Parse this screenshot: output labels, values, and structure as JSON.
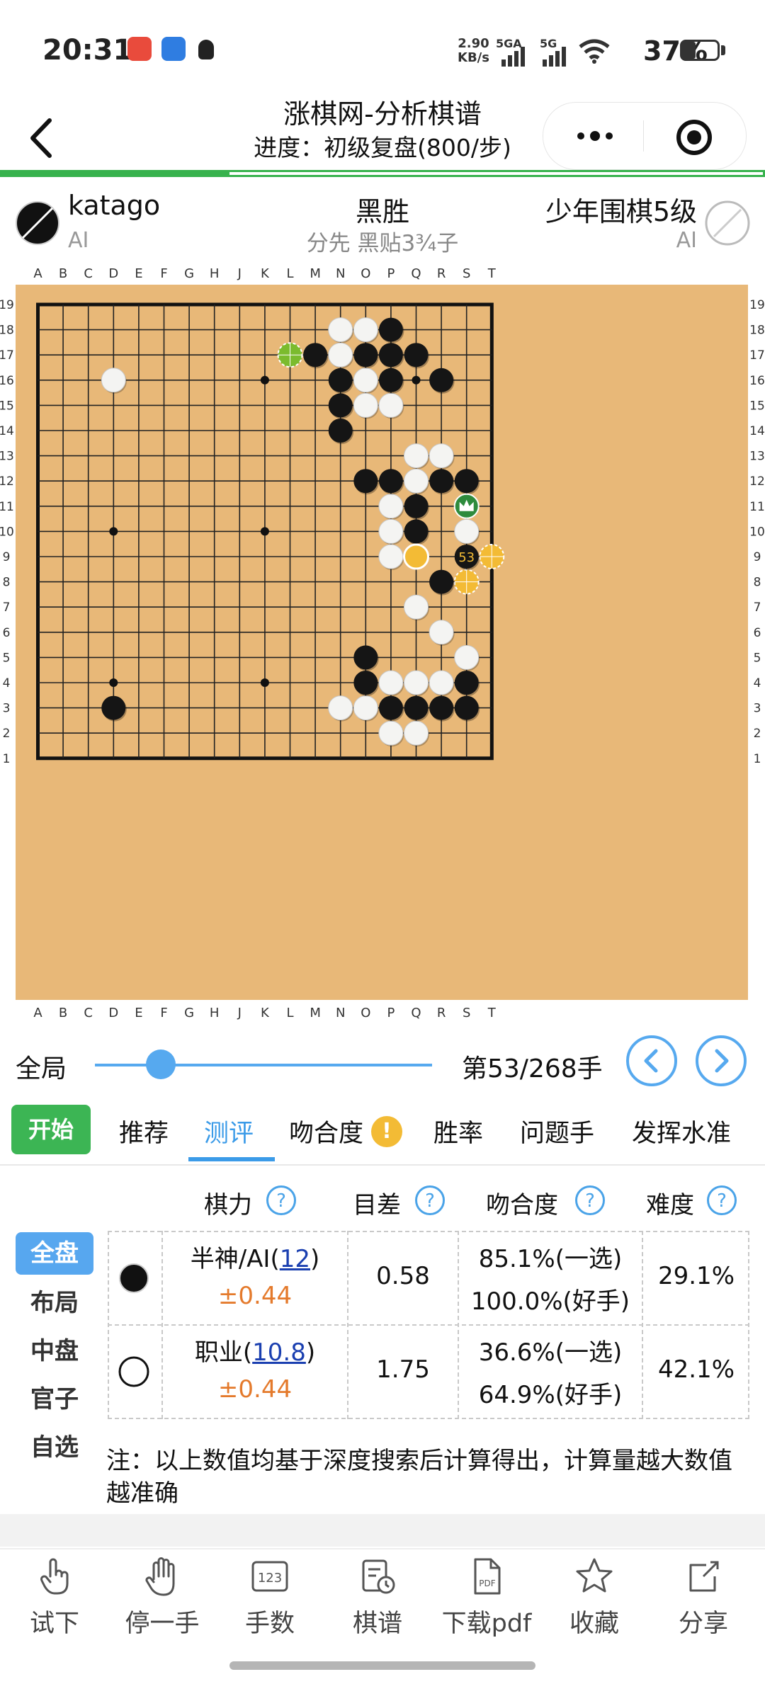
{
  "status": {
    "time": "20:31",
    "net_speed_value": "2.90",
    "net_speed_unit": "KB/s",
    "signal1_label": "5GA",
    "signal2_label": "5G",
    "battery": "37%",
    "battery_level": 0.37
  },
  "header": {
    "title": "涨棋网-分析棋谱",
    "subtitle": "进度：初级复盘(800/步)",
    "progress_fraction": 0.3
  },
  "players": {
    "black": {
      "name": "katago",
      "type": "AI"
    },
    "white": {
      "name": "少年围棋5级",
      "type": "AI"
    },
    "result": "黑胜",
    "rules": "分先 黑贴3¾子"
  },
  "board": {
    "columns": [
      "A",
      "B",
      "C",
      "D",
      "E",
      "F",
      "G",
      "H",
      "J",
      "K",
      "L",
      "M",
      "N",
      "O",
      "P",
      "Q",
      "R",
      "S",
      "T"
    ],
    "rows": [
      "19",
      "18",
      "17",
      "16",
      "15",
      "14",
      "13",
      "12",
      "11",
      "10",
      "9",
      "8",
      "7",
      "6",
      "5",
      "4",
      "3",
      "2",
      "1"
    ],
    "last_move": "S9",
    "last_move_number": "53",
    "black_stones": [
      "P18",
      "M17",
      "O17",
      "P17",
      "Q17",
      "N16",
      "P16",
      "R16",
      "N15",
      "N14",
      "O12",
      "P12",
      "R12",
      "S12",
      "Q11",
      "Q10",
      "R8",
      "O5",
      "O4",
      "S4",
      "P3",
      "Q3",
      "R3",
      "S3",
      "D3",
      "S9"
    ],
    "white_stones": [
      "N18",
      "O18",
      "N17",
      "D16",
      "O16",
      "O15",
      "P15",
      "Q13",
      "R13",
      "Q12",
      "P11",
      "S10",
      "P10",
      "P9",
      "Q7",
      "R6",
      "S5",
      "P4",
      "Q4",
      "R4",
      "N3",
      "O3",
      "P2",
      "Q2"
    ],
    "highlight_stone": "Q9",
    "candidate_marks": [
      {
        "point": "L17",
        "color": "#7bbb2e"
      },
      {
        "point": "T9",
        "color": "#f3bb35"
      },
      {
        "point": "S8",
        "color": "#f3bb35"
      }
    ],
    "crown_point": "S11",
    "star_points": [
      "D16",
      "K16",
      "Q16",
      "D10",
      "K10",
      "Q10",
      "D4",
      "K4",
      "Q4"
    ]
  },
  "navigation": {
    "full_label": "全局",
    "current_move": 53,
    "total_moves": 268,
    "counter_text": "第53/268手"
  },
  "tabs": {
    "start": "开始",
    "items": [
      "推荐",
      "测评",
      "吻合度",
      "胜率",
      "问题手",
      "发挥水准"
    ],
    "active": "测评",
    "warning_badge": "!"
  },
  "evaluation": {
    "headers": [
      "棋力",
      "目差",
      "吻合度",
      "难度"
    ],
    "help_symbol": "?",
    "categories": [
      "全盘",
      "布局",
      "中盘",
      "官子",
      "自选"
    ],
    "active_category": "全盘",
    "rows": [
      {
        "player": "black",
        "level": "半神/AI(",
        "level_score": "12",
        "level_close": ")",
        "margin": "±0.44",
        "diff": "0.58",
        "match1": "85.1%(一选)",
        "match2": "100.0%(好手)",
        "difficulty": "29.1%"
      },
      {
        "player": "white",
        "level": "职业(",
        "level_score": "10.8",
        "level_close": ")",
        "margin": "±0.44",
        "diff": "1.75",
        "match1": "36.6%(一选)",
        "match2": "64.9%(好手)",
        "difficulty": "42.1%"
      }
    ],
    "note": "注：以上数值均基于深度搜索后计算得出，计算量越大数值越准确"
  },
  "toolbar": {
    "items": [
      {
        "label": "试下",
        "icon": "tap-hand-icon"
      },
      {
        "label": "停一手",
        "icon": "stop-hand-icon"
      },
      {
        "label": "手数",
        "icon": "move-number-icon",
        "icon_text": "123"
      },
      {
        "label": "棋谱",
        "icon": "record-history-icon"
      },
      {
        "label": "下载pdf",
        "icon": "pdf-file-icon",
        "icon_text": "PDF"
      },
      {
        "label": "收藏",
        "icon": "star-icon"
      },
      {
        "label": "分享",
        "icon": "share-icon"
      }
    ]
  },
  "colors": {
    "accent_blue": "#56a9ef",
    "start_green": "#3cb554",
    "board_wood": "#e5b573",
    "margin_orange": "#e47a2c"
  }
}
